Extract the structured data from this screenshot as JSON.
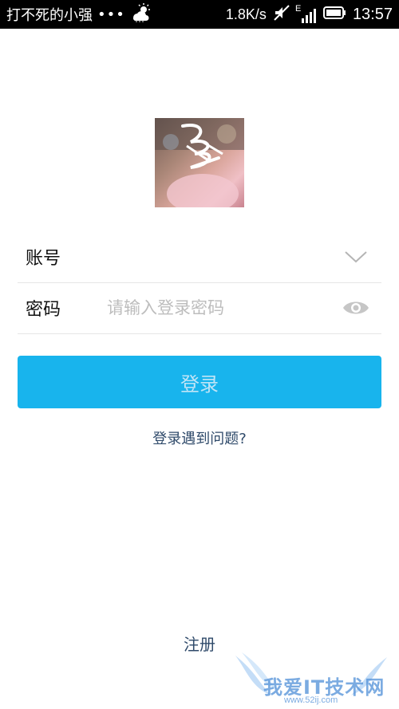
{
  "status_bar": {
    "carrier_text": "打不死的小强",
    "dots": "•••",
    "network_speed": "1.8K/s",
    "network_type": "E",
    "time": "13:57",
    "icons": [
      "weather-cloud-sun-icon",
      "mute-icon",
      "signal-icon",
      "battery-icon"
    ]
  },
  "avatar": {
    "description": "user-avatar"
  },
  "form": {
    "account_label": "账号",
    "account_value": "",
    "password_label": "密码",
    "password_placeholder": "请输入登录密码"
  },
  "login_button": {
    "label": "登录"
  },
  "problem_link": "登录遇到问题?",
  "register_link": "注册",
  "watermark": {
    "text": "我爱IT技术网",
    "url": "www.52ij.com"
  },
  "colors": {
    "primary": "#18b4ed",
    "link": "#2f4a6a",
    "status_bar": "#000000"
  }
}
